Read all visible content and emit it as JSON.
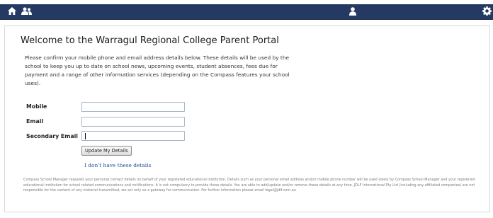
{
  "portal": {
    "title": "Welcome to the Warragul Regional College Parent Portal",
    "intro": "Please confirm your mobile phone and email address details below. These details will be used by the school to keep you up to date on school news, upcoming events, student absences, fees due for payment and a range of other information services (depending on the Compass features your school uses).",
    "form": {
      "mobile_label": "Mobile",
      "email_label": "Email",
      "secondary_email_label": "Secondary Email",
      "mobile_value": "",
      "email_value": "",
      "secondary_email_value": ""
    },
    "update_button": "Update My Details",
    "no_details_link": "I don't have these details",
    "disclaimer": "Compass School Manager requests your personal contact details on behalf of your registered educational institution. Details such as your personal email address and/or mobile phone number will be used solely by Compass School Manager and your registered educational institution for school related communications and notifications. It is not compulsory to provide these details. You are able to add/update and/or remove these details at any time. JDLF International Pty Ltd (including any affiliated companies) are not responsible for the content of any material transmitted, we act only as a gateway for communication. For further information please email legal@jdlf.com.au"
  },
  "topbar": {
    "icons": [
      "home-icon",
      "people-icon",
      "user-icon",
      "settings-icon"
    ],
    "background_color": "#243a63"
  }
}
